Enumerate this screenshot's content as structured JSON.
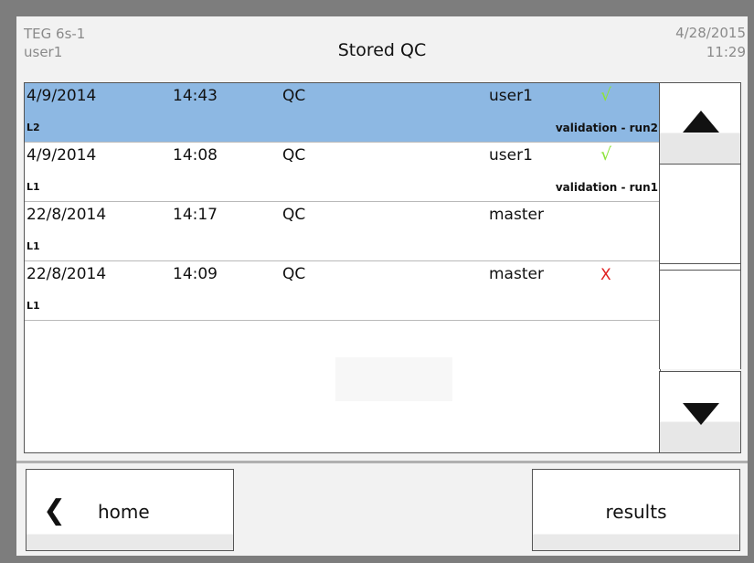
{
  "header": {
    "device_name": "TEG 6s-1",
    "user": "user1",
    "title": "Stored QC",
    "date": "4/28/2015",
    "time": "11:29"
  },
  "rows": [
    {
      "date": "4/9/2014",
      "time": "14:43",
      "type": "QC",
      "user": "user1",
      "status": "√",
      "level": "L2",
      "note": "validation - run2",
      "selected": true
    },
    {
      "date": "4/9/2014",
      "time": "14:08",
      "type": "QC",
      "user": "user1",
      "status": "√",
      "level": "L1",
      "note": "validation - run1",
      "selected": false
    },
    {
      "date": "22/8/2014",
      "time": "14:17",
      "type": "QC",
      "user": "master",
      "status": "",
      "level": "L1",
      "note": "",
      "selected": false
    },
    {
      "date": "22/8/2014",
      "time": "14:09",
      "type": "QC",
      "user": "master",
      "status": "X",
      "level": "L1",
      "note": "",
      "selected": false
    }
  ],
  "scroll": {
    "up_icon": "triangle-up-icon",
    "down_icon": "triangle-down-icon"
  },
  "footer": {
    "home_label": "home",
    "home_icon": "chevron-left-icon",
    "results_label": "results"
  },
  "colors": {
    "selected_row": "#8db8e3",
    "pass": "#8de33a",
    "fail": "#e02020"
  }
}
